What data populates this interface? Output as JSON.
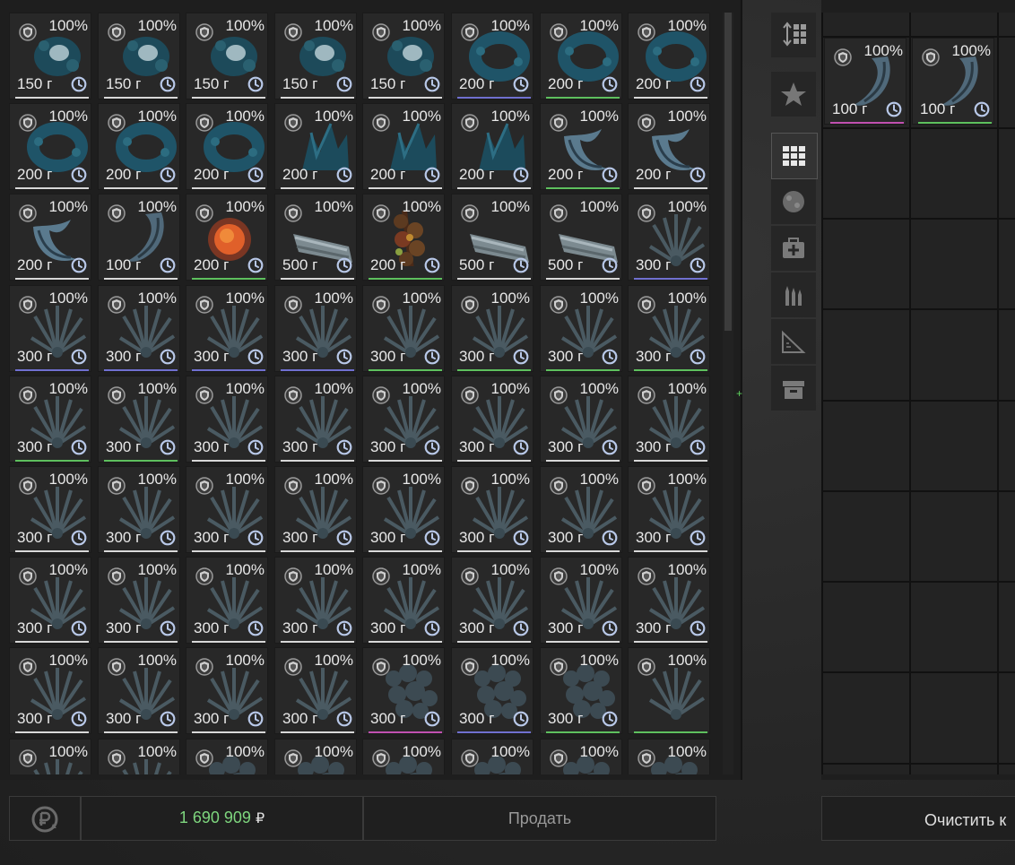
{
  "inventory": {
    "items": [
      {
        "pct": "100%",
        "weight": "150 г",
        "kind": "rock",
        "underline": "#d8d8d8"
      },
      {
        "pct": "100%",
        "weight": "150 г",
        "kind": "rock",
        "underline": "#d8d8d8"
      },
      {
        "pct": "100%",
        "weight": "150 г",
        "kind": "rock",
        "underline": "#d8d8d8"
      },
      {
        "pct": "100%",
        "weight": "150 г",
        "kind": "rock",
        "underline": "#d8d8d8"
      },
      {
        "pct": "100%",
        "weight": "150 г",
        "kind": "rock",
        "underline": "#d8d8d8"
      },
      {
        "pct": "100%",
        "weight": "200 г",
        "kind": "ring",
        "underline": "#7070d0"
      },
      {
        "pct": "100%",
        "weight": "200 г",
        "kind": "ring",
        "underline": "#5ec05e"
      },
      {
        "pct": "100%",
        "weight": "200 г",
        "kind": "ring",
        "underline": "#d8d8d8"
      },
      {
        "pct": "100%",
        "weight": "200 г",
        "kind": "ring",
        "underline": "#d8d8d8"
      },
      {
        "pct": "100%",
        "weight": "200 г",
        "kind": "ring",
        "underline": "#d8d8d8"
      },
      {
        "pct": "100%",
        "weight": "200 г",
        "kind": "ring",
        "underline": "#d8d8d8"
      },
      {
        "pct": "100%",
        "weight": "200 г",
        "kind": "crystal",
        "underline": "#d8d8d8"
      },
      {
        "pct": "100%",
        "weight": "200 г",
        "kind": "crystal",
        "underline": "#d8d8d8"
      },
      {
        "pct": "100%",
        "weight": "200 г",
        "kind": "crystal",
        "underline": "#d8d8d8"
      },
      {
        "pct": "100%",
        "weight": "200 г",
        "kind": "claw",
        "underline": "#5ec05e"
      },
      {
        "pct": "100%",
        "weight": "200 г",
        "kind": "claw",
        "underline": "#d8d8d8"
      },
      {
        "pct": "100%",
        "weight": "200 г",
        "kind": "claw",
        "underline": "#d8d8d8"
      },
      {
        "pct": "100%",
        "weight": "100 г",
        "kind": "horn",
        "underline": "#d8d8d8"
      },
      {
        "pct": "100%",
        "weight": "200 г",
        "kind": "orb",
        "underline": "#5ec05e"
      },
      {
        "pct": "100%",
        "weight": "500 г",
        "kind": "log",
        "underline": "#d8d8d8"
      },
      {
        "pct": "100%",
        "weight": "200 г",
        "kind": "berries",
        "underline": "#5ec05e"
      },
      {
        "pct": "100%",
        "weight": "500 г",
        "kind": "log",
        "underline": "#d8d8d8"
      },
      {
        "pct": "100%",
        "weight": "500 г",
        "kind": "log",
        "underline": "#d8d8d8"
      },
      {
        "pct": "100%",
        "weight": "300 г",
        "kind": "fern",
        "underline": "#7070d0"
      },
      {
        "pct": "100%",
        "weight": "300 г",
        "kind": "fern",
        "underline": "#7070d0"
      },
      {
        "pct": "100%",
        "weight": "300 г",
        "kind": "fern",
        "underline": "#7070d0"
      },
      {
        "pct": "100%",
        "weight": "300 г",
        "kind": "fern",
        "underline": "#7070d0"
      },
      {
        "pct": "100%",
        "weight": "300 г",
        "kind": "fern",
        "underline": "#7070d0"
      },
      {
        "pct": "100%",
        "weight": "300 г",
        "kind": "fern",
        "underline": "#5ec05e"
      },
      {
        "pct": "100%",
        "weight": "300 г",
        "kind": "fern",
        "underline": "#5ec05e"
      },
      {
        "pct": "100%",
        "weight": "300 г",
        "kind": "fern",
        "underline": "#5ec05e"
      },
      {
        "pct": "100%",
        "weight": "300 г",
        "kind": "fern",
        "underline": "#5ec05e"
      },
      {
        "pct": "100%",
        "weight": "300 г",
        "kind": "fern",
        "underline": "#5ec05e"
      },
      {
        "pct": "100%",
        "weight": "300 г",
        "kind": "fern",
        "underline": "#5ec05e"
      },
      {
        "pct": "100%",
        "weight": "300 г",
        "kind": "fern",
        "underline": "#d8d8d8"
      },
      {
        "pct": "100%",
        "weight": "300 г",
        "kind": "fern",
        "underline": "#d8d8d8"
      },
      {
        "pct": "100%",
        "weight": "300 г",
        "kind": "fern",
        "underline": "#d8d8d8"
      },
      {
        "pct": "100%",
        "weight": "300 г",
        "kind": "fern",
        "underline": "#d8d8d8"
      },
      {
        "pct": "100%",
        "weight": "300 г",
        "kind": "fern",
        "underline": "#d8d8d8"
      },
      {
        "pct": "100%",
        "weight": "300 г",
        "kind": "fern",
        "underline": "#d8d8d8"
      },
      {
        "pct": "100%",
        "weight": "300 г",
        "kind": "fern",
        "underline": "#d8d8d8"
      },
      {
        "pct": "100%",
        "weight": "300 г",
        "kind": "fern",
        "underline": "#d8d8d8"
      },
      {
        "pct": "100%",
        "weight": "300 г",
        "kind": "fern",
        "underline": "#d8d8d8"
      },
      {
        "pct": "100%",
        "weight": "300 г",
        "kind": "fern",
        "underline": "#d8d8d8"
      },
      {
        "pct": "100%",
        "weight": "300 г",
        "kind": "fern",
        "underline": "#d8d8d8"
      },
      {
        "pct": "100%",
        "weight": "300 г",
        "kind": "fern",
        "underline": "#d8d8d8"
      },
      {
        "pct": "100%",
        "weight": "300 г",
        "kind": "fern",
        "underline": "#d8d8d8"
      },
      {
        "pct": "100%",
        "weight": "300 г",
        "kind": "fern",
        "underline": "#d8d8d8"
      },
      {
        "pct": "100%",
        "weight": "300 г",
        "kind": "fern",
        "underline": "#d8d8d8"
      },
      {
        "pct": "100%",
        "weight": "300 г",
        "kind": "fern",
        "underline": "#d8d8d8"
      },
      {
        "pct": "100%",
        "weight": "300 г",
        "kind": "fern",
        "underline": "#d8d8d8"
      },
      {
        "pct": "100%",
        "weight": "300 г",
        "kind": "fern",
        "underline": "#d8d8d8"
      },
      {
        "pct": "100%",
        "weight": "300 г",
        "kind": "fern",
        "underline": "#d8d8d8"
      },
      {
        "pct": "100%",
        "weight": "300 г",
        "kind": "fern",
        "underline": "#d8d8d8"
      },
      {
        "pct": "100%",
        "weight": "300 г",
        "kind": "fern",
        "underline": "#d8d8d8"
      },
      {
        "pct": "100%",
        "weight": "300 г",
        "kind": "fern",
        "underline": "#d8d8d8"
      },
      {
        "pct": "100%",
        "weight": "300 г",
        "kind": "fern",
        "underline": "#d8d8d8"
      },
      {
        "pct": "100%",
        "weight": "300 г",
        "kind": "fern",
        "underline": "#d8d8d8"
      },
      {
        "pct": "100%",
        "weight": "300 г",
        "kind": "fern",
        "underline": "#d8d8d8"
      },
      {
        "pct": "100%",
        "weight": "300 г",
        "kind": "fern",
        "underline": "#d8d8d8"
      },
      {
        "pct": "100%",
        "weight": "300 г",
        "kind": "coral",
        "underline": "#c050b0"
      },
      {
        "pct": "100%",
        "weight": "300 г",
        "kind": "coral",
        "underline": "#7070d0"
      },
      {
        "pct": "100%",
        "weight": "300 г",
        "kind": "coral",
        "underline": "#5ec05e"
      },
      {
        "pct": "100%",
        "weight": "",
        "kind": "fern",
        "underline": "#5ec05e"
      },
      {
        "pct": "100%",
        "weight": "",
        "kind": "fern",
        "underline": "#d8d8d8"
      },
      {
        "pct": "100%",
        "weight": "",
        "kind": "fern",
        "underline": "#d8d8d8"
      },
      {
        "pct": "100%",
        "weight": "",
        "kind": "coral",
        "underline": "#d8d8d8"
      },
      {
        "pct": "100%",
        "weight": "",
        "kind": "coral",
        "underline": "#d8d8d8"
      },
      {
        "pct": "100%",
        "weight": "",
        "kind": "coral",
        "underline": "#d8d8d8"
      },
      {
        "pct": "100%",
        "weight": "",
        "kind": "coral",
        "underline": "#d8d8d8"
      },
      {
        "pct": "100%",
        "weight": "",
        "kind": "coral",
        "underline": "#d8d8d8"
      },
      {
        "pct": "100%",
        "weight": "",
        "kind": "coral",
        "underline": "#d8d8d8"
      }
    ]
  },
  "tabs": [
    {
      "icon": "sort-grid-icon"
    },
    {
      "icon": "star-icon"
    },
    {
      "icon": "grid-icon",
      "active": true
    },
    {
      "icon": "artifact-icon"
    },
    {
      "icon": "medkit-icon"
    },
    {
      "icon": "ammo-icon"
    },
    {
      "icon": "ruler-icon"
    },
    {
      "icon": "box-icon"
    }
  ],
  "sell_items": [
    {
      "pct": "100%",
      "weight": "100 г",
      "kind": "horn",
      "underline": "#c050b0"
    },
    {
      "pct": "100%",
      "weight": "100 г",
      "kind": "horn",
      "underline": "#5ec05e"
    }
  ],
  "footer": {
    "money": "1 690 909",
    "currency": "₽",
    "sell_label": "Продать",
    "clear_label": "Очистить к"
  },
  "colors": {
    "money": "#7ed67e",
    "text": "#e8e8e8",
    "icon": "#b8c8e8"
  }
}
